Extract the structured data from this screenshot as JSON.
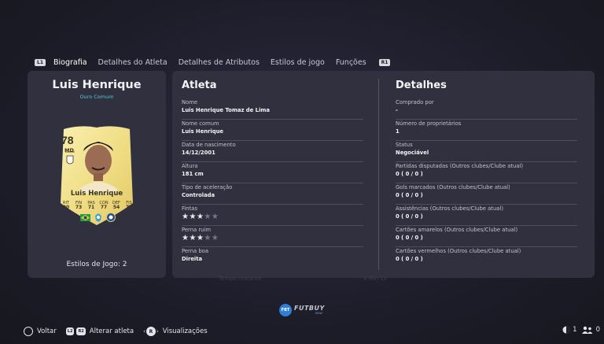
{
  "tabs": {
    "left_button": "L1",
    "right_button": "R1",
    "items": [
      "Biografia",
      "Detalhes do Atleta",
      "Detalhes de Atributos",
      "Estilos de jogo",
      "Funções"
    ]
  },
  "player": {
    "name": "Luis Henrique",
    "rarity": "Ouro Comum",
    "card": {
      "rating": "78",
      "position": "MD",
      "name": "Luis Henrique",
      "stats": [
        {
          "label": "RIT",
          "value": "90"
        },
        {
          "label": "FIN",
          "value": "73"
        },
        {
          "label": "PAS",
          "value": "71"
        },
        {
          "label": "CON",
          "value": "77"
        },
        {
          "label": "DEF",
          "value": "54"
        },
        {
          "label": "FIS",
          "value": "77"
        }
      ]
    },
    "playstyles": "Estilos de Jogo: 2"
  },
  "athlete": {
    "title": "Atleta",
    "fields": [
      {
        "label": "Nome",
        "value": "Luis Henrique Tomaz de Lima"
      },
      {
        "label": "Nome comum",
        "value": "Luis Henrique"
      },
      {
        "label": "Data de nascimento",
        "value": "14/12/2001"
      },
      {
        "label": "Altura",
        "value": "181 cm"
      },
      {
        "label": "Tipo de aceleração",
        "value": "Controlada"
      },
      {
        "label": "Fintas",
        "stars": 3
      },
      {
        "label": "Perna ruim",
        "stars": 3
      },
      {
        "label": "Perna boa",
        "value": "Direita"
      }
    ]
  },
  "details": {
    "title": "Detalhes",
    "fields": [
      {
        "label": "Comprado por",
        "value": "-"
      },
      {
        "label": "Número de proprietários",
        "value": "1"
      },
      {
        "label": "Status",
        "value": "Negociável"
      },
      {
        "label": "Partidas disputadas (Outros clubes/Clube atual)",
        "value": "0 ( 0 / 0 )"
      },
      {
        "label": "Gols marcados (Outros clubes/Clube atual)",
        "value": "0 ( 0 / 0 )"
      },
      {
        "label": "Assistências (Outros clubes/Clube atual)",
        "value": "0 ( 0 / 0 )"
      },
      {
        "label": "Cartões amarelos (Outros clubes/Clube atual)",
        "value": "0 ( 0 / 0 )"
      },
      {
        "label": "Cartões vermelhos (Outros clubes/Clube atual)",
        "value": "0 ( 0 / 0 )"
      }
    ]
  },
  "background_text": {
    "left": "Tempo restante",
    "right": "8 Min 1s"
  },
  "logo": {
    "badge": "FBT",
    "text": "FUTBUY",
    "sub": "NOW"
  },
  "bottom_bar": {
    "back_button": "O",
    "back_label": "Voltar",
    "l2_button": "L2",
    "r2_button": "R2",
    "change_label": "Alterar atleta",
    "r_button": "R",
    "views_label": "Visualizações",
    "online_count": "1",
    "party_count": "0"
  },
  "colors": {
    "panel": "#30303f",
    "rarity": "#54c8e4",
    "card_gold": "#f3e48e",
    "card_text": "#3b3320"
  }
}
